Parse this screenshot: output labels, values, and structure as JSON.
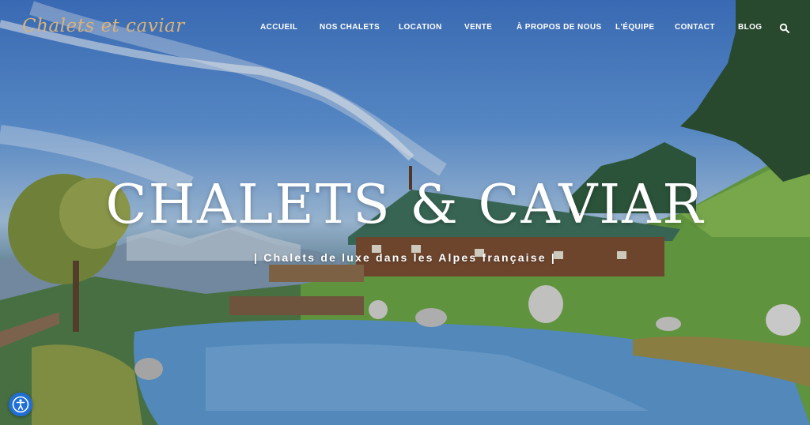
{
  "logo": {
    "text": "Chalets et caviar"
  },
  "nav": {
    "items": [
      {
        "label": "ACCUEIL"
      },
      {
        "label": "NOS CHALETS"
      },
      {
        "label": "LOCATION"
      },
      {
        "label": "VENTE"
      },
      {
        "label": "À PROPOS DE NOUS"
      },
      {
        "label": "L'ÉQUIPE"
      },
      {
        "label": "CONTACT"
      },
      {
        "label": "BLOG"
      }
    ],
    "search_icon": "search-icon"
  },
  "hero": {
    "title": "CHALETS & CAVIAR",
    "subtitle": "| Chalets de luxe dans les Alpes française |"
  },
  "accessibility": {
    "icon": "accessibility-icon"
  },
  "colors": {
    "logo": "#d9b27a",
    "nav_text": "#ffffff",
    "accessibility_button": "#1f6fd6"
  }
}
